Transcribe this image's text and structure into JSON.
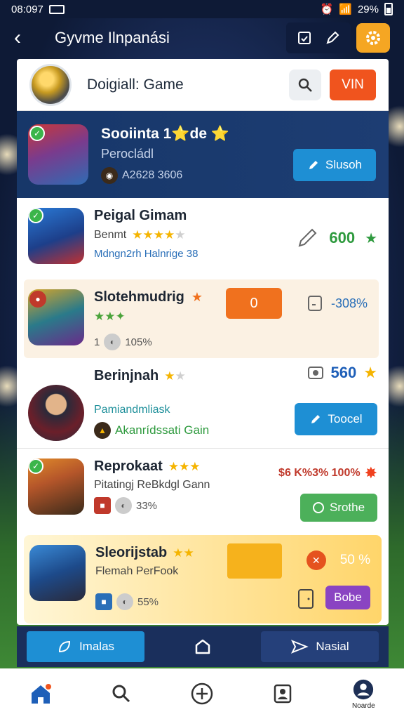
{
  "status_bar": {
    "time": "08:097"
  },
  "status_battery": "29%",
  "app_bar": {
    "title": "Gyvme Ilnpanási"
  },
  "header": {
    "title": "Doigiall: Game",
    "vin_label": "VIN"
  },
  "featured": {
    "title": "Sooiinta 1⭐de ⭐",
    "subtitle": "Perocládl",
    "meta": "A2628 3606",
    "button_label": "Slusoh"
  },
  "rows": [
    {
      "title": "Peigal Gimam",
      "sub": "Benmt",
      "meta": "Mdngn2rh Halnrige 38",
      "value": "600",
      "stars": 4,
      "stars_total": 5
    },
    {
      "title": "Slotehmudrig",
      "meta_left": "1",
      "meta": "105%",
      "value": "-308%",
      "orange_label": "0"
    },
    {
      "title": "Berinjnah",
      "sub": "Pamiandmliask",
      "meta": "Akanrídssati Gain",
      "value": "560",
      "button_label": "Toocel"
    },
    {
      "title": "Reprokaat",
      "sub": "Pitatingj ReBkdgl Gann",
      "meta": "33%",
      "value": "$6 K%3% 100%",
      "button_label": "Srothe"
    },
    {
      "title": "Sleorijstab",
      "sub": "Flemah PerFook",
      "meta": "55%",
      "value": "50 %",
      "button_label": "Bobe"
    }
  ],
  "action_bar": {
    "left_label": "Imalas",
    "right_label": "Nasial"
  },
  "bottom_nav": {
    "profile_label": "Noarde"
  },
  "colors": {
    "accent_orange": "#f0541e",
    "accent_blue": "#1e8fd4",
    "accent_green": "#3bb54a",
    "gold": "#f5a623",
    "navy": "#173769"
  }
}
